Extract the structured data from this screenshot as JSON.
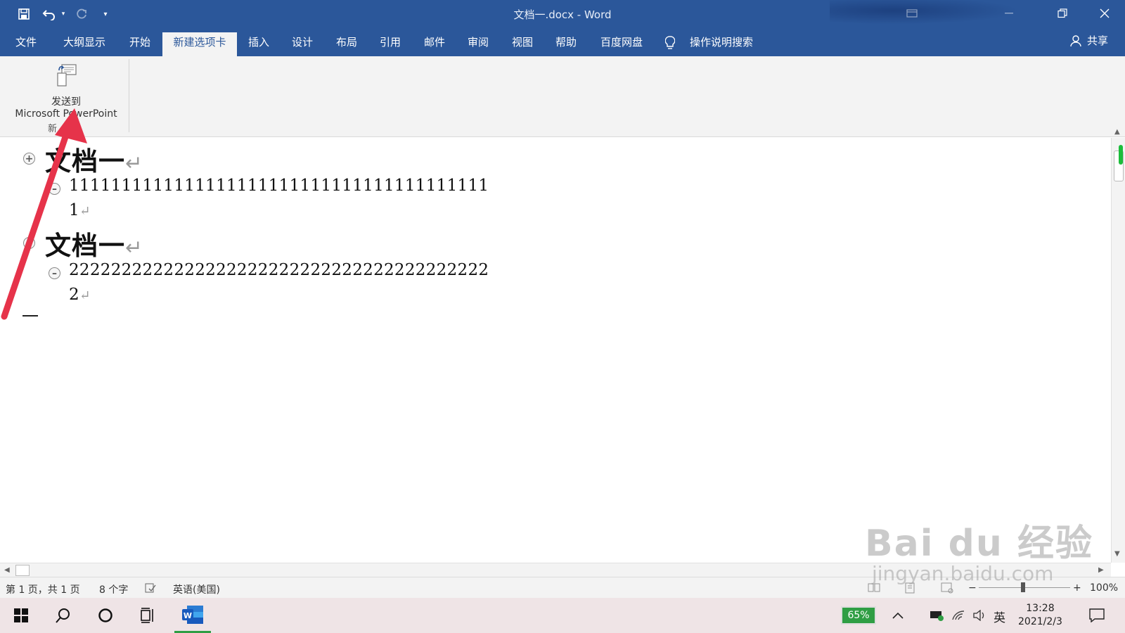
{
  "window": {
    "title": "文档一.docx  -  Word",
    "accent_color": "#2b579a"
  },
  "qat": {
    "save_icon": "save-icon",
    "undo_icon": "undo-icon",
    "redo_icon": "redo-icon",
    "customize_icon": "chevron-down-icon"
  },
  "tabs": [
    {
      "label": "文件"
    },
    {
      "label": "大纲显示"
    },
    {
      "label": "开始"
    },
    {
      "label": "新建选项卡",
      "active": true
    },
    {
      "label": "插入"
    },
    {
      "label": "设计"
    },
    {
      "label": "布局"
    },
    {
      "label": "引用"
    },
    {
      "label": "邮件"
    },
    {
      "label": "审阅"
    },
    {
      "label": "视图"
    },
    {
      "label": "帮助"
    },
    {
      "label": "百度网盘"
    },
    {
      "label": "操作说明搜索"
    }
  ],
  "share_label": "共享",
  "ribbon": {
    "send_button": {
      "line1": "发送到",
      "line2": "Microsoft PowerPoint"
    },
    "group_label": "新"
  },
  "document": {
    "headings": [
      {
        "text": "文档一",
        "body": [
          "1111111111111111111111111111111111111111",
          "1"
        ]
      },
      {
        "text": "文档一",
        "body": [
          "2222222222222222222222222222222222222222",
          "2"
        ]
      }
    ],
    "paragraph_mark": "↵"
  },
  "status": {
    "page": "第 1 页，共 1 页",
    "words": "8 个字",
    "language": "英语(美国)",
    "zoom": "100%"
  },
  "taskbar": {
    "battery": "65%",
    "ime": "英",
    "time": "13:28",
    "date": "2021/2/3"
  },
  "watermark": {
    "line1": "Bai du 经验",
    "line2": "jingyan.baidu.com"
  }
}
